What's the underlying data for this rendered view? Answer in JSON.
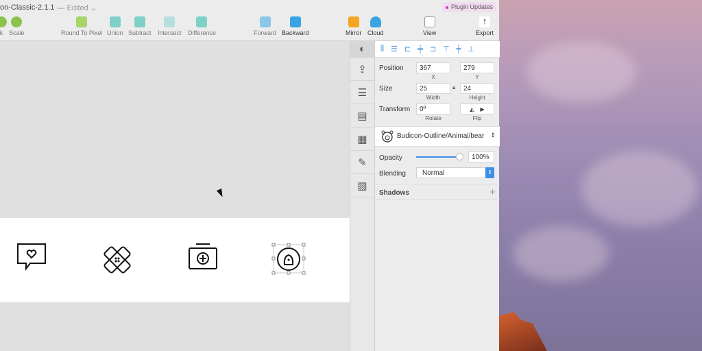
{
  "window": {
    "title": "on-Classic-2.1.1",
    "edited": "— Edited ⌄",
    "plugin_updates": "Plugin Updates"
  },
  "toolbar": {
    "items": [
      {
        "label": "k",
        "color": "#8bc34a"
      },
      {
        "label": "Scale",
        "color": "#8bc34a"
      },
      {
        "label": "Round To Pixel",
        "color": "#a5d66a"
      },
      {
        "label": "Union",
        "color": "#7fd0c8"
      },
      {
        "label": "Subtract",
        "color": "#7fd0c8"
      },
      {
        "label": "Intersect",
        "color": "#b5e0dc"
      },
      {
        "label": "Difference",
        "color": "#7fd0c8"
      },
      {
        "label": "Forward",
        "color": "#8cc6ea"
      },
      {
        "label": "Backward",
        "color": "#3aa3e3"
      },
      {
        "label": "Mirror",
        "color": "#f5a623"
      },
      {
        "label": "Cloud",
        "color": "#3aa3e3"
      },
      {
        "label": "View",
        "color": "#ffffff"
      },
      {
        "label": "Export",
        "color": "#ffffff"
      }
    ]
  },
  "inspector": {
    "position_label": "Position",
    "x": "367",
    "y": "279",
    "x_label": "X",
    "y_label": "Y",
    "size_label": "Size",
    "width": "25",
    "height": "24",
    "width_label": "Width",
    "height_label": "Height",
    "transform_label": "Transform",
    "rotate": "0º",
    "rotate_label": "Rotate",
    "flip_label": "Flip",
    "symbol": "Budicon-Outline/Animal/bear",
    "opacity_label": "Opacity",
    "opacity": "100%",
    "opacity_value": 1.0,
    "blending_label": "Blending",
    "blending": "Normal",
    "shadows_label": "Shadows"
  },
  "colors": {
    "accent": "#3d8ee8"
  }
}
